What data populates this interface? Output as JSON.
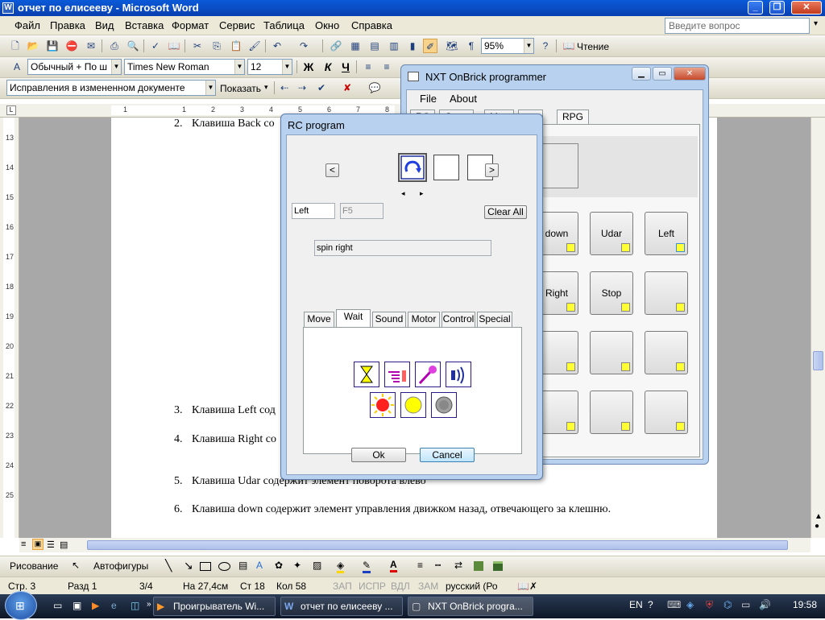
{
  "word": {
    "title": "отчет по елисееву - Microsoft Word",
    "menu": [
      "Файл",
      "Правка",
      "Вид",
      "Вставка",
      "Формат",
      "Сервис",
      "Таблица",
      "Окно",
      "Справка"
    ],
    "help_placeholder": "Введите вопрос",
    "zoom": "95%",
    "read_label": "Чтение",
    "style": "Обычный + По ш",
    "font": "Times New Roman",
    "size": "12",
    "bold": "Ж",
    "italic": "К",
    "underline": "Ч",
    "review_combo": "Исправления в измененном документе",
    "show_label": "Показать",
    "document": {
      "lines": [
        {
          "num": "2.",
          "text": "Клавиша Back со"
        },
        {
          "num": "3.",
          "text": "Клавиша Left сод"
        },
        {
          "num": "4.",
          "text": "Клавиша Right со"
        },
        {
          "num": "5.",
          "text": "Клавиша Udar содержит элемент поворота влево"
        },
        {
          "num": "6.",
          "text": "Клавиша down содержит элемент управления движком назад, отвечающего за клешню."
        }
      ]
    },
    "ruler_h": [
      "1",
      "1",
      "2",
      "3",
      "4",
      "5",
      "6",
      "7",
      "8"
    ],
    "ruler_v": [
      "13",
      "14",
      "15",
      "16",
      "17",
      "18",
      "19",
      "20",
      "21",
      "22",
      "23",
      "24",
      "25"
    ],
    "drawing": {
      "draw_label": "Рисование",
      "autoshapes_label": "Автофигуры"
    },
    "status": {
      "page": "Стр. 3",
      "section": "Разд 1",
      "pages": "3/4",
      "at": "На 27,4см",
      "line": "Ст 18",
      "col": "Кол 58",
      "rec": "ЗАП",
      "trk": "ИСПР",
      "ext": "ВДЛ",
      "ovr": "ЗАМ",
      "lang": "русский (Ро"
    }
  },
  "nxt": {
    "title": "NXT OnBrick programmer",
    "menu": [
      "File",
      "About"
    ],
    "tabs": [
      "RC",
      "Gene",
      "Mus",
      "ers",
      "RPG"
    ],
    "keys": [
      {
        "label": "down"
      },
      {
        "label": "Udar"
      },
      {
        "label": "Left"
      },
      {
        "label": "Right"
      },
      {
        "label": "Stop"
      },
      {
        "label": ""
      },
      {
        "label": ""
      },
      {
        "label": ""
      },
      {
        "label": ""
      },
      {
        "label": ""
      },
      {
        "label": ""
      },
      {
        "label": ""
      }
    ]
  },
  "rc": {
    "title": "RC program",
    "nav_prev": "<",
    "nav_next": ">",
    "arrow_left": "◂",
    "arrow_right": "▸",
    "name_value": "Left",
    "key_value": "F5",
    "clear_all": "Clear All",
    "description": "spin right",
    "tabs": [
      "Move",
      "Wait",
      "Sound",
      "Motor",
      "Control",
      "Special"
    ],
    "ok": "Ok",
    "cancel": "Cancel"
  },
  "taskbar": {
    "items": [
      "Проигрыватель Wi...",
      "отчет по елисееву ...",
      "NXT OnBrick progra..."
    ],
    "lang": "EN",
    "time": "19:58"
  },
  "colors": {
    "led": "#ffff33",
    "title_blue": "#0a5ad8",
    "wait_yellow": "#ffff00",
    "wait_red": "#ff2020"
  }
}
